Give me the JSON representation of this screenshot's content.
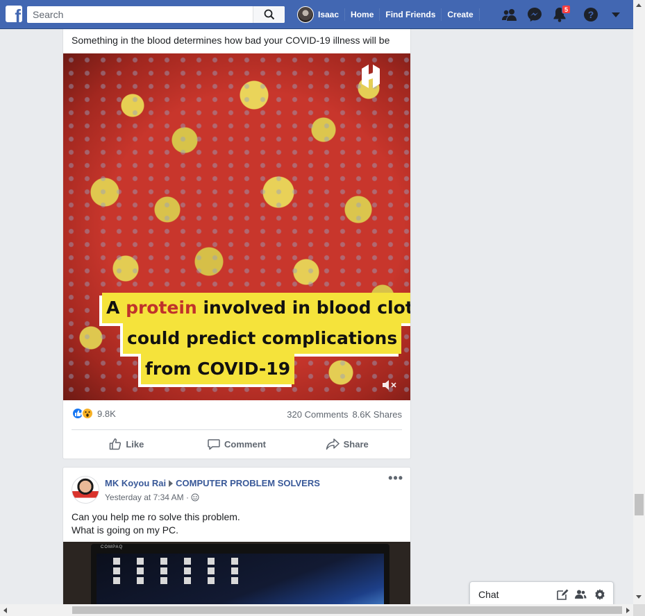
{
  "topbar": {
    "search_placeholder": "Search",
    "profile_name": "Isaac",
    "nav_home": "Home",
    "nav_find_friends": "Find Friends",
    "nav_create": "Create",
    "notification_count": "5",
    "brand_color": "#4267b2"
  },
  "post1": {
    "text": "Something in the blood determines how bad your COVID-19 illness will be",
    "video_caption": {
      "line1_prefix": "A ",
      "line1_highlight": "protein",
      "line1_suffix": " involved in blood clotting",
      "line2": "could predict complications",
      "line3": "from COVID-19"
    },
    "reaction_count": "9.8K",
    "comments": "320 Comments",
    "shares": "8.6K Shares",
    "actions": {
      "like": "Like",
      "comment": "Comment",
      "share": "Share"
    }
  },
  "post2": {
    "author": "MK Koyou Rai",
    "group": "COMPUTER PROBLEM SOLVERS",
    "timestamp": "Yesterday at 7:34 AM ·",
    "text_line1": "Can you help me ro solve this problem.",
    "text_line2": "What is going on my PC.",
    "monitor_brand": "COMPAQ"
  },
  "chat": {
    "label": "Chat"
  },
  "icons": {
    "logo": "facebook-logo-icon",
    "search": "search-icon",
    "friends": "friend-requests-icon",
    "messenger": "messenger-icon",
    "notifications": "notifications-bell-icon",
    "help": "help-icon",
    "account_menu": "chevron-down-icon"
  }
}
